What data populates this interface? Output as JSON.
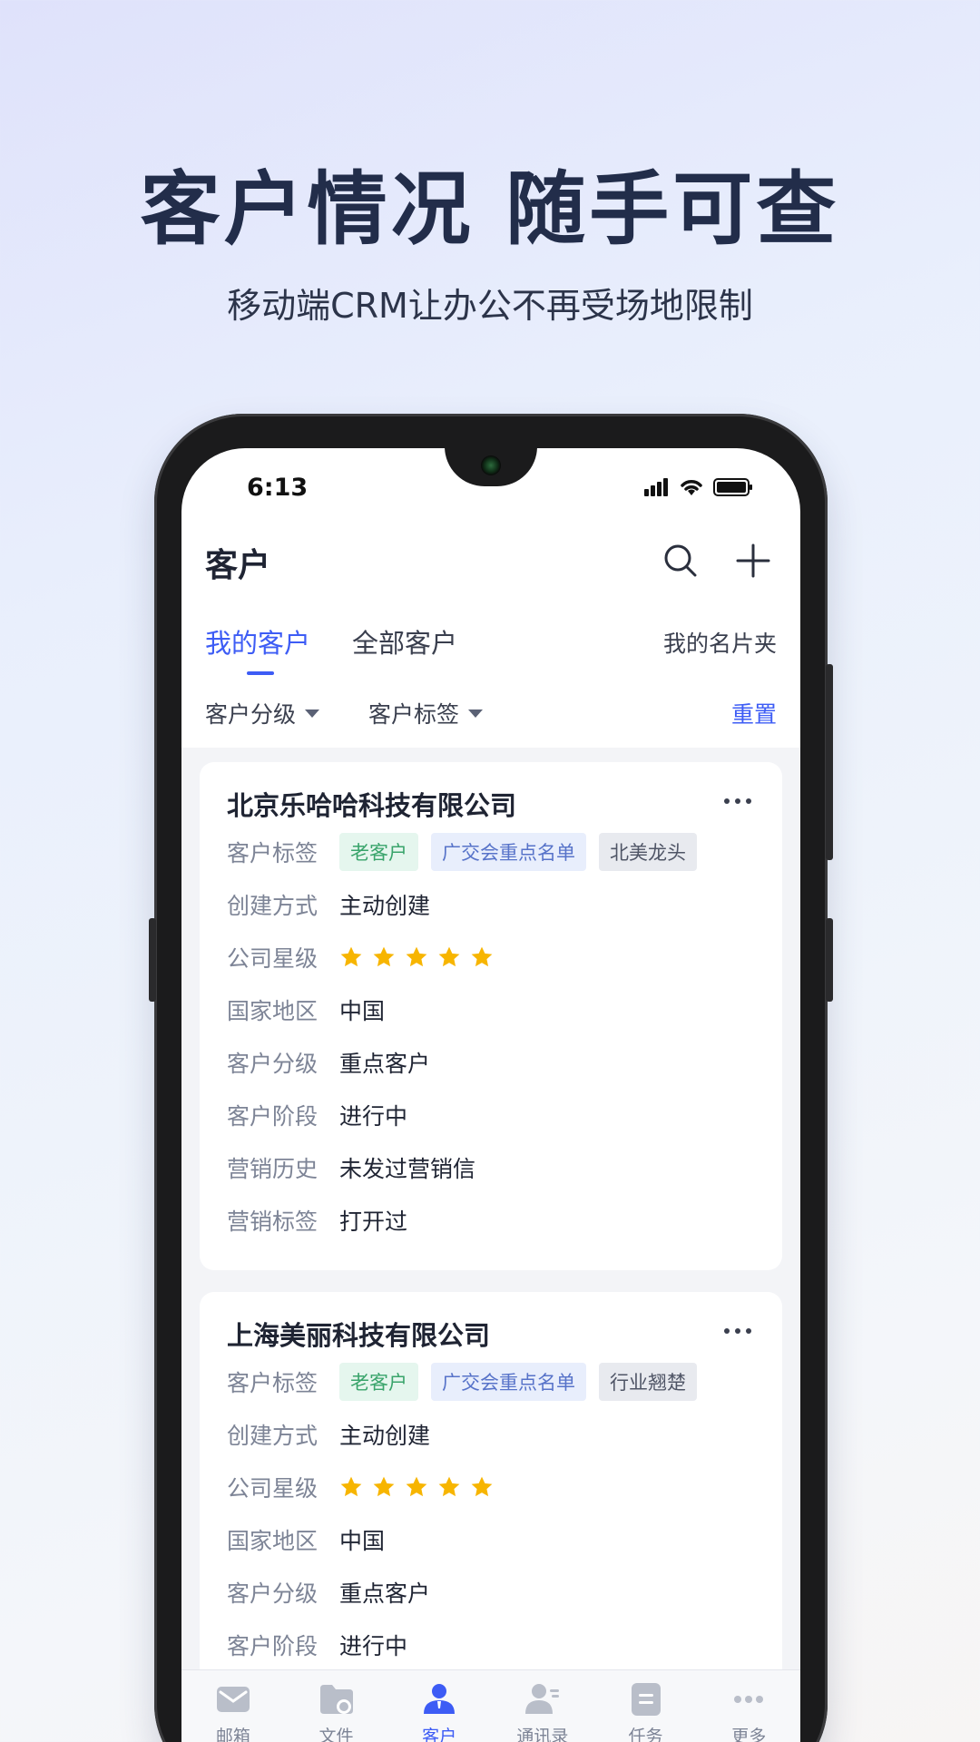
{
  "headline": "客户情况 随手可查",
  "subline": "移动端CRM让办公不再受场地限制",
  "status": {
    "time": "6:13"
  },
  "header": {
    "title": "客户"
  },
  "tabs": [
    {
      "label": "我的客户",
      "active": true
    },
    {
      "label": "全部客户",
      "active": false
    }
  ],
  "tab_right": "我的名片夹",
  "filters": [
    {
      "label": "客户分级"
    },
    {
      "label": "客户标签"
    }
  ],
  "reset": "重置",
  "labels": {
    "tags": "客户标签",
    "create": "创建方式",
    "stars": "公司星级",
    "country": "国家地区",
    "grade": "客户分级",
    "stage": "客户阶段",
    "history": "营销历史",
    "mtag": "营销标签"
  },
  "cards": [
    {
      "name": "北京乐哈哈科技有限公司",
      "tags": [
        "老客户",
        "广交会重点名单",
        "北美龙头"
      ],
      "create": "主动创建",
      "stars": 5,
      "country": "中国",
      "grade": "重点客户",
      "stage": "进行中",
      "history": "未发过营销信",
      "mtag": "打开过"
    },
    {
      "name": "上海美丽科技有限公司",
      "tags": [
        "老客户",
        "广交会重点名单",
        "行业翘楚"
      ],
      "create": "主动创建",
      "stars": 5,
      "country": "中国",
      "grade": "重点客户",
      "stage": "进行中"
    }
  ],
  "tabbar": [
    {
      "label": "邮箱",
      "icon": "mail-icon"
    },
    {
      "label": "文件",
      "icon": "folder-icon"
    },
    {
      "label": "客户",
      "icon": "customer-icon",
      "active": true
    },
    {
      "label": "通讯录",
      "icon": "contacts-icon"
    },
    {
      "label": "任务",
      "icon": "task-icon"
    },
    {
      "label": "更多",
      "icon": "more-icon"
    }
  ],
  "colors": {
    "accent": "#3d5cf5",
    "star": "#f7b500"
  }
}
